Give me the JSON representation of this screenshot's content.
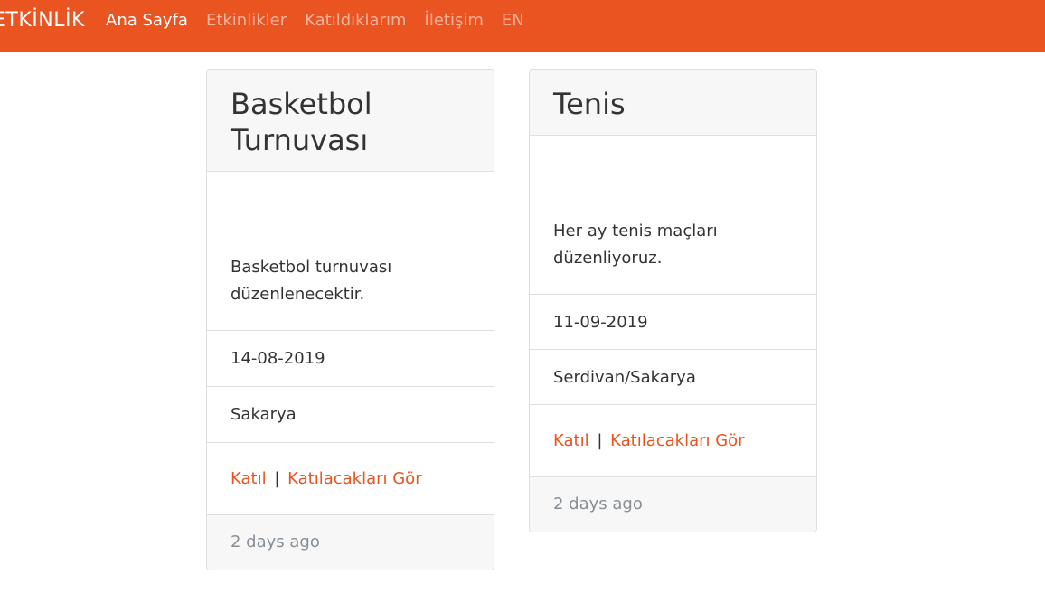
{
  "navbar": {
    "brand": "ETKİNLİK",
    "items": [
      {
        "label": "Ana Sayfa",
        "active": true
      },
      {
        "label": "Etkinlikler",
        "active": false
      },
      {
        "label": "Katıldıklarım",
        "active": false
      },
      {
        "label": "İletişim",
        "active": false
      },
      {
        "label": "EN",
        "active": false
      }
    ]
  },
  "events": [
    {
      "title": "Basketbol Turnuvası",
      "description": "Basketbol turnuvası düzenlenecektir.",
      "date": "14-08-2019",
      "location": "Sakarya",
      "join_label": "Katıl",
      "separator": "|",
      "attendees_label": "Katılacakları Gör",
      "posted": "2 days ago"
    },
    {
      "title": "Tenis",
      "description": "Her ay tenis maçları düzenliyoruz.",
      "date": "11-09-2019",
      "location": "Serdivan/Sakarya",
      "join_label": "Katıl",
      "separator": "|",
      "attendees_label": "Katılacakları Gör",
      "posted": "2 days ago"
    }
  ],
  "colors": {
    "primary": "#e95420",
    "muted": "#868e96",
    "border": "#dfdfdf",
    "card_header_bg": "#f7f7f7"
  }
}
